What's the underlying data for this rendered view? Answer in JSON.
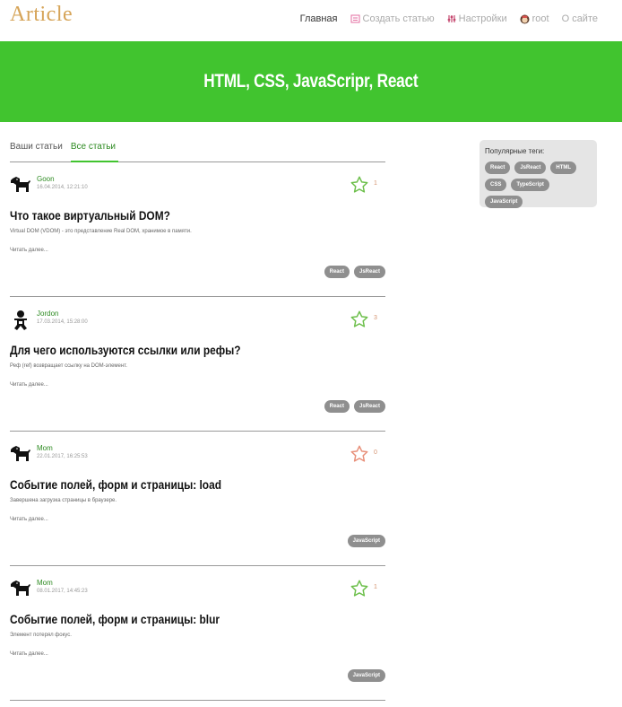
{
  "header": {
    "logo": "Article",
    "nav": [
      {
        "label": "Главная",
        "icon": "",
        "active": true
      },
      {
        "label": "Создать статью",
        "icon": "create-icon",
        "active": false
      },
      {
        "label": "Настройки",
        "icon": "settings-icon",
        "active": false
      },
      {
        "label": "root",
        "icon": "user-icon",
        "active": false
      },
      {
        "label": "О сайте",
        "icon": "",
        "active": false
      }
    ]
  },
  "banner": {
    "title": "HTML, CSS, JavaScripr, React",
    "color": "#41c42f"
  },
  "feed": {
    "tabs": [
      {
        "label": "Ваши статьи",
        "active": false
      },
      {
        "label": "Все статьи",
        "active": true
      }
    ],
    "read_more": "Читать далее...",
    "articles": [
      {
        "author": "Goon",
        "date": "16.04.2014, 12:21:10",
        "avatar": "dog-icon",
        "likes": "1",
        "liked": true,
        "title": "Что такое виртуальный DOM?",
        "description": "Virtual DOM (VDOM) - это представление Real DOM, хранимое в памяти.",
        "tags": [
          "React",
          "JsReact"
        ]
      },
      {
        "author": "Jordon",
        "date": "17.03.2014, 15:28:00",
        "avatar": "baby-icon",
        "likes": "3",
        "liked": true,
        "title": "Для чего используются ссылки или рефы?",
        "description": "Реф (ref) возвращает ссылку на DOM-элемент.",
        "tags": [
          "React",
          "JsReact"
        ]
      },
      {
        "author": "Mom",
        "date": "22.01.2017, 16:25:53",
        "avatar": "dog-icon",
        "likes": "0",
        "liked": false,
        "title": "Событие полей, форм и страницы: load",
        "description": "Завершена загрузка страницы в браузере.",
        "tags": [
          "JavaScript"
        ]
      },
      {
        "author": "Mom",
        "date": "08.01.2017, 14:45:23",
        "avatar": "dog-icon",
        "likes": "1",
        "liked": true,
        "title": "Событие полей, форм и страницы: blur",
        "description": "Элемент потерял фокус.",
        "tags": [
          "JavaScript"
        ]
      }
    ]
  },
  "sidebar": {
    "title": "Популярные теги:",
    "tags": [
      "React",
      "JsReact",
      "HTML",
      "CSS",
      "TypeScript",
      "JavaScript"
    ]
  },
  "colors": {
    "accent": "#41c42f",
    "star_liked": "#6cbf4a",
    "star_unliked": "#e8907a",
    "tag": "#8f8f8f"
  }
}
